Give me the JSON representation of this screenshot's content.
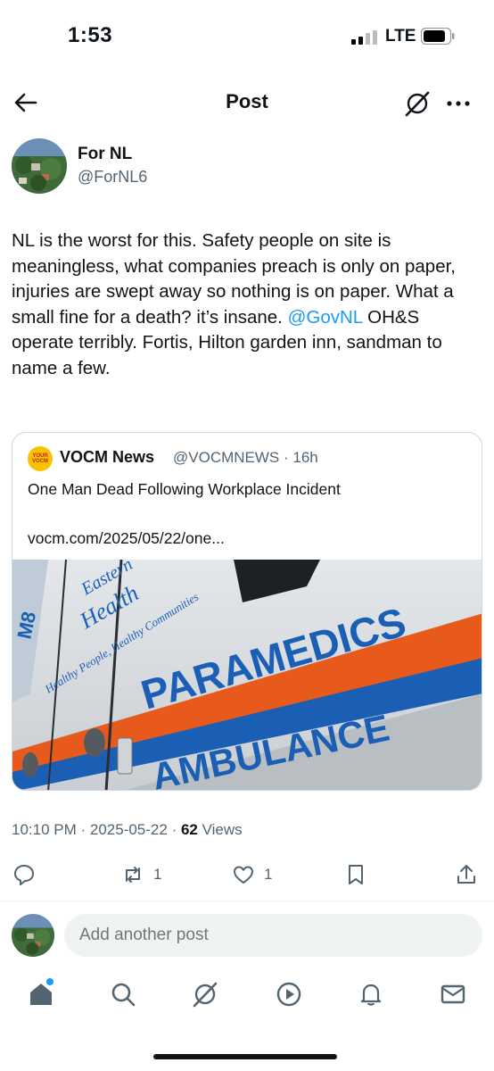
{
  "status_bar": {
    "time": "1:53",
    "network": "LTE"
  },
  "header": {
    "title": "Post"
  },
  "author": {
    "name": "For NL",
    "handle": "@ForNL6"
  },
  "post": {
    "text_before": "NL is the worst for this. Safety people on site is meaningless, what companies preach is only on paper, injuries are swept away so nothing is on paper. What a small fine for a death? it’s insane. ",
    "mention": "@GovNL",
    "text_after": " OH&S operate terribly. Fortis, Hilton garden inn, sandman to name a few."
  },
  "quote": {
    "name": "VOCM News",
    "meta": "@VOCMNEWS · 16h",
    "logo_text_1": "YOUR",
    "logo_text_2": "VOCM",
    "headline": "One Man Dead Following Workplace Incident",
    "link": "vocm.com/2025/05/22/one...",
    "image_text_1": "PARAMEDICS",
    "image_text_2": "AMBULANCE",
    "image_text_3": "Eastern",
    "image_text_4": "Health",
    "image_text_5": "Healthy People, Healthy Communities",
    "image_text_6": "M8"
  },
  "meta": {
    "time": "10:10 PM",
    "date": "2025-05-22",
    "views_count": "62",
    "views_label": "Views"
  },
  "actions": {
    "reposts": "1",
    "likes": "1"
  },
  "reply": {
    "placeholder": "Add another post"
  },
  "colors": {
    "accent": "#1d9bf0",
    "text": "#0f1419",
    "secondary": "#536471"
  }
}
